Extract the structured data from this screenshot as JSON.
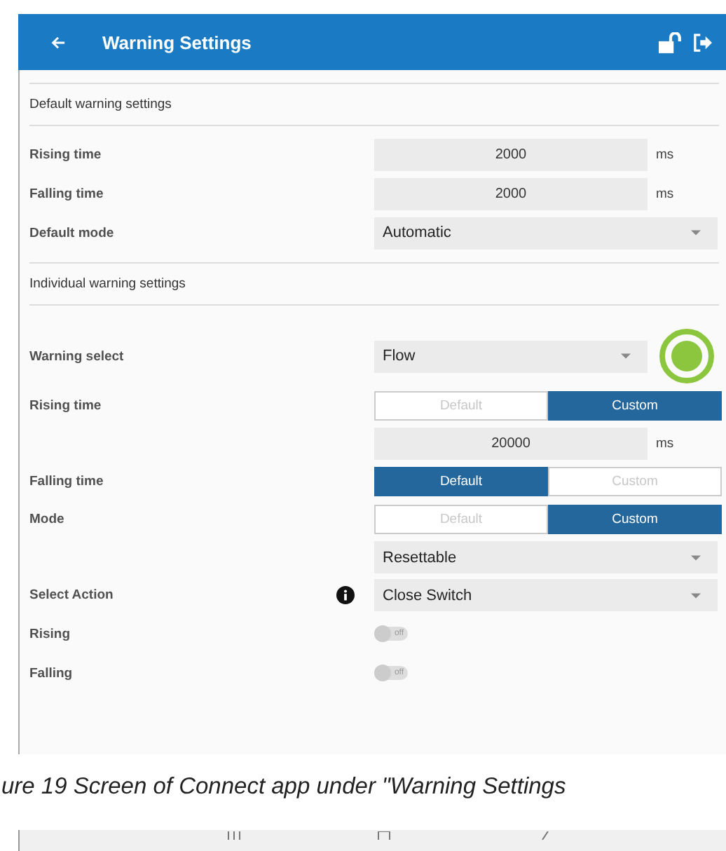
{
  "app_bar": {
    "title": "Warning Settings"
  },
  "default_section": {
    "heading": "Default warning settings",
    "rows": [
      {
        "kind": "number",
        "label": "Rising time",
        "value": "2000",
        "unit": "ms"
      },
      {
        "kind": "number",
        "label": "Falling time",
        "value": "2000",
        "unit": "ms"
      },
      {
        "kind": "dropdown",
        "label": "Default mode",
        "value": "Automatic"
      }
    ]
  },
  "individual_section": {
    "heading": "Individual warning settings",
    "rows": [
      {
        "kind": "dropdown",
        "label": "Warning select",
        "value": "Flow",
        "color": "#8cc63f"
      },
      {
        "kind": "segmented",
        "label": "Rising time",
        "options": [
          {
            "label": "Default",
            "selected": false
          },
          {
            "label": "Custom",
            "selected": true
          }
        ]
      },
      {
        "kind": "number",
        "value": "20000",
        "unit": "ms"
      },
      {
        "kind": "segmented",
        "label": "Falling time",
        "options": [
          {
            "label": "Default",
            "selected": true
          },
          {
            "label": "Custom",
            "selected": false
          }
        ]
      },
      {
        "kind": "segmented",
        "label": "Mode",
        "options": [
          {
            "label": "Default",
            "selected": false
          },
          {
            "label": "Custom",
            "selected": true
          }
        ]
      },
      {
        "kind": "dropdown",
        "value": "Resettable"
      },
      {
        "kind": "dropdown",
        "label": "Select Action",
        "value": "Close Switch",
        "info": true
      },
      {
        "kind": "toggle",
        "label": "Rising",
        "on": false,
        "toggle_text": "off"
      },
      {
        "kind": "toggle",
        "label": "Falling",
        "on": false,
        "toggle_text": "off"
      }
    ]
  },
  "caption": "ure 19 Screen of Connect app under \"Warning Settings"
}
